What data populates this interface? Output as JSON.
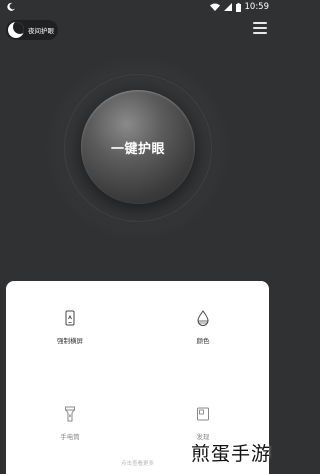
{
  "status_bar": {
    "time": "10:59"
  },
  "app": {
    "name": "夜间护眼"
  },
  "main": {
    "eye_button_label": "一键护眼"
  },
  "panel": {
    "tiles": [
      {
        "label": "强制横屏",
        "icon": "rotate-phone-icon"
      },
      {
        "label": "颜色",
        "icon": "color-drop-icon"
      },
      {
        "label": "手电筒",
        "icon": "flashlight-icon"
      },
      {
        "label": "发现",
        "icon": "discover-icon"
      }
    ],
    "more_text": "点击查看更多"
  },
  "watermark": {
    "text": "煎蛋手游"
  }
}
